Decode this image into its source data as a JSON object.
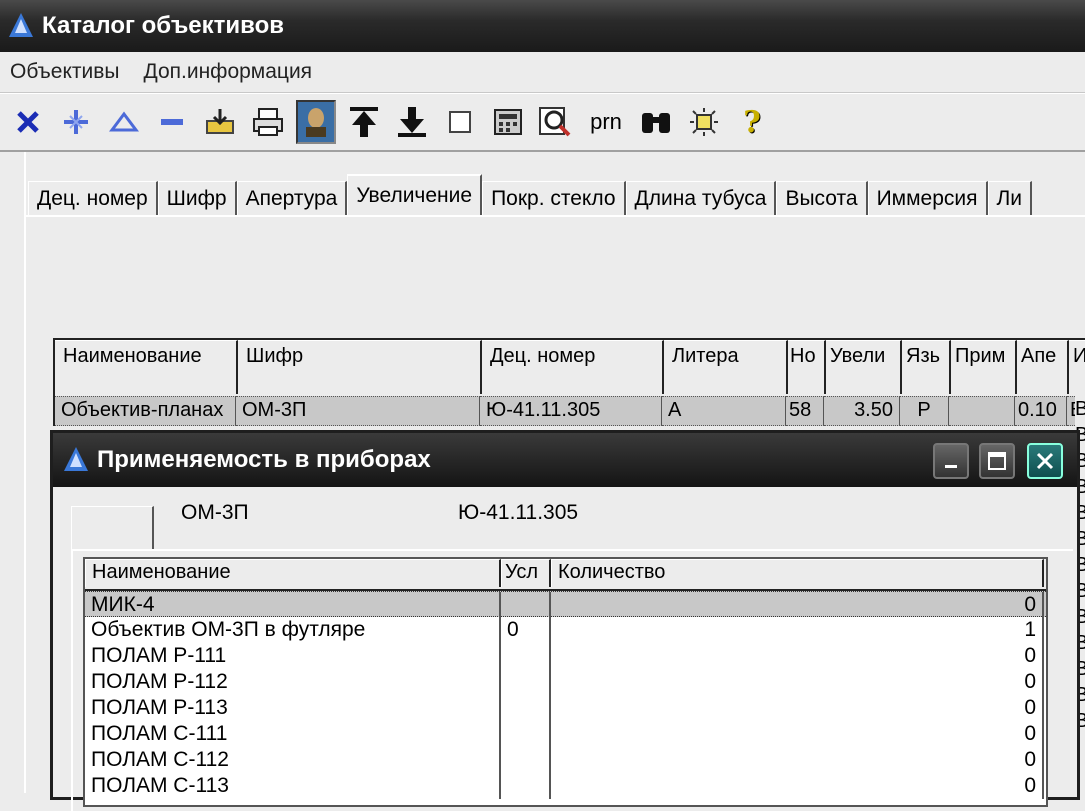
{
  "window": {
    "title": "Каталог объективов"
  },
  "menu": [
    "Объективы",
    "Доп.информация"
  ],
  "toolbar": {
    "prn_label": "prn",
    "icons": [
      "delete-icon",
      "insert-icon",
      "up-icon",
      "minus-icon",
      "export-icon",
      "print-icon",
      "portrait-icon",
      "move-top-icon",
      "move-bottom-icon",
      "checkbox-icon",
      "calculator-icon",
      "preview-icon",
      "prn",
      "binoculars-icon",
      "light-icon",
      "help-icon"
    ]
  },
  "tabs": [
    {
      "label": "Дец. номер"
    },
    {
      "label": "Шифр"
    },
    {
      "label": "Апертура"
    },
    {
      "label": "Увеличение",
      "active": true
    },
    {
      "label": "Покр. стекло"
    },
    {
      "label": "Длина тубуса"
    },
    {
      "label": "Высота"
    },
    {
      "label": "Иммерсия"
    },
    {
      "label": "Ли"
    }
  ],
  "grid": {
    "columns": [
      "Наименование",
      "Шифр",
      "Дец. номер",
      "Литера",
      "Но",
      "Увели",
      "Язь",
      "Прим",
      "Апе",
      "И"
    ],
    "row": [
      "Объектив-планах",
      "ОМ-3П",
      "Ю-41.11.305",
      "А",
      "58",
      "3.50",
      "Р",
      "",
      "0.10",
      "В"
    ]
  },
  "dialog": {
    "title": "Применяемость в приборах",
    "code": "ОМ-3П",
    "dec_number": "Ю-41.11.305",
    "columns": [
      "Наименование",
      "Усл",
      "Количество"
    ],
    "rows": [
      {
        "name": "МИК-4",
        "usl": "",
        "qty": "0"
      },
      {
        "name": "Объектив ОМ-3П в футляре",
        "usl": "0",
        "qty": "1"
      },
      {
        "name": "ПОЛАМ Р-111",
        "usl": "",
        "qty": "0"
      },
      {
        "name": "ПОЛАМ Р-112",
        "usl": "",
        "qty": "0"
      },
      {
        "name": "ПОЛАМ Р-113",
        "usl": "",
        "qty": "0"
      },
      {
        "name": "ПОЛАМ С-111",
        "usl": "",
        "qty": "0"
      },
      {
        "name": "ПОЛАМ С-112",
        "usl": "",
        "qty": "0"
      },
      {
        "name": "ПОЛАМ С-113",
        "usl": "",
        "qty": "0"
      }
    ]
  },
  "right_strip": [
    "В",
    "В",
    "В",
    "В",
    "В",
    "В",
    "В",
    "В",
    "В",
    "В",
    "В",
    "В",
    "В"
  ]
}
